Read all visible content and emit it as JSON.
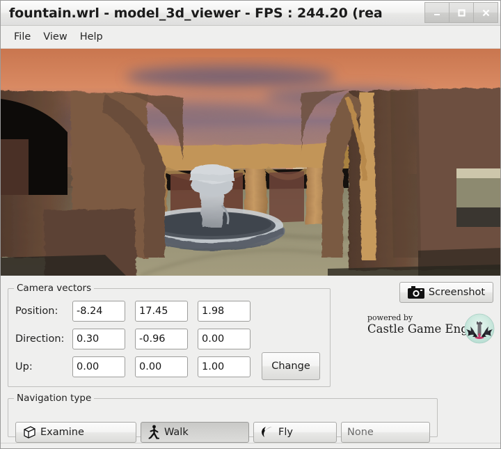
{
  "window": {
    "title": "fountain.wrl - model_3d_viewer - FPS : 244.20 (rea",
    "controls": [
      {
        "name": "minimize",
        "glyph": "minimize-icon"
      },
      {
        "name": "maximize",
        "glyph": "maximize-icon"
      },
      {
        "name": "close",
        "glyph": "close-icon"
      }
    ]
  },
  "menubar": {
    "items": [
      {
        "label": "File"
      },
      {
        "label": "View"
      },
      {
        "label": "Help"
      }
    ]
  },
  "viewport": {
    "name": "3d-scene-viewport",
    "description": "3D rendered fountain scene with stone arches under a sunset sky",
    "colors": {
      "sky_top": "#d98a63",
      "sky_cloud": "#7b6c7e",
      "sky_low": "#e0a07d",
      "stone_dark": "#4a372c",
      "stone_mid": "#8a6a4c",
      "stone_light": "#c99a63",
      "ground": "#8d8a70",
      "fountain": "#b9bcc0",
      "shadow": "#2b2b28"
    }
  },
  "camera_panel": {
    "legend": "Camera vectors",
    "rows": [
      {
        "label": "Position:",
        "values": [
          "-8.24",
          "17.45",
          "1.98"
        ]
      },
      {
        "label": "Direction:",
        "values": [
          "0.30",
          "-0.96",
          "0.00"
        ]
      },
      {
        "label": "Up:",
        "values": [
          "0.00",
          "0.00",
          "1.00"
        ]
      }
    ],
    "change_button": "Change"
  },
  "screenshot": {
    "label": "Screenshot",
    "icon": "camera-icon"
  },
  "branding": {
    "line1": "powered by",
    "line2": "Castle Game Engine",
    "logo": "castle-game-engine-logo",
    "logo_colors": {
      "badge": "#cfeae0",
      "silhouette": "#2d2d33",
      "accent": "#c4396a"
    }
  },
  "navigation_panel": {
    "legend": "Navigation type",
    "buttons": [
      {
        "label": "Examine",
        "icon": "cube-icon",
        "active": false,
        "enabled": true
      },
      {
        "label": "Walk",
        "icon": "walking-person-icon",
        "active": true,
        "enabled": true
      },
      {
        "label": "Fly",
        "icon": "bird-icon",
        "active": false,
        "enabled": true
      },
      {
        "label": "None",
        "icon": "none",
        "active": false,
        "enabled": false
      }
    ]
  }
}
